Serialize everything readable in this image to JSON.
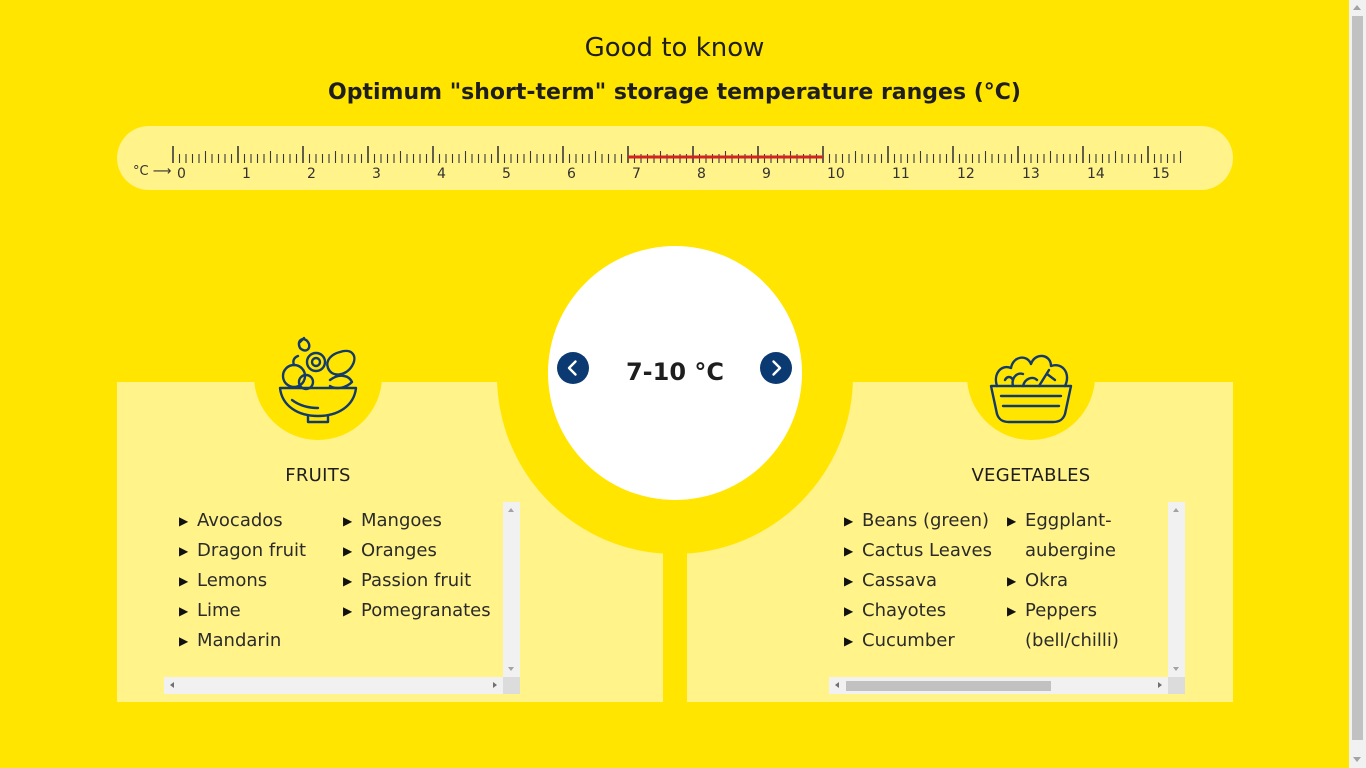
{
  "header": {
    "title": "Good to know",
    "subtitle": "Optimum \"short-term\" storage temperature ranges (°C)"
  },
  "ruler": {
    "unit_label": "°C ⟶",
    "ticks": [
      "0",
      "1",
      "2",
      "3",
      "4",
      "5",
      "6",
      "7",
      "8",
      "9",
      "10",
      "11",
      "12",
      "13",
      "14",
      "15"
    ],
    "range_min": 0,
    "range_max": 15,
    "highlight_from": 7,
    "highlight_to": 10,
    "highlight_color": "#D32222"
  },
  "selector": {
    "value": "7-10 °C",
    "prev_icon": "chevron-left-icon",
    "next_icon": "chevron-right-icon",
    "button_color": "#0B3A73"
  },
  "fruits": {
    "heading": "FRUITS",
    "icon": "fruit-bowl-icon",
    "column1": [
      "Avocados",
      "Dragon fruit",
      "Lemons",
      "Lime",
      "Mandarin"
    ],
    "column2": [
      "Mangoes",
      "Oranges",
      "Passion fruit",
      "Pomegranates"
    ]
  },
  "vegetables": {
    "heading": "VEGETABLES",
    "icon": "vegetable-basket-icon",
    "column1": [
      "Beans (green)",
      "Cactus Leaves",
      "Cassava",
      "Chayotes",
      "Cucumber"
    ],
    "column2": [
      "Eggplant-aubergine",
      "Okra",
      "Peppers (bell/chilli)"
    ]
  },
  "colors": {
    "background": "#FFE500",
    "panel": "#FFF38A",
    "icon_stroke": "#123A6B"
  }
}
